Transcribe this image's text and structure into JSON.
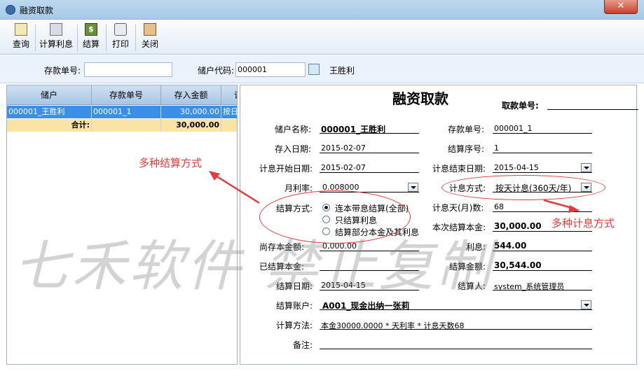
{
  "window": {
    "title": "融资取款",
    "close_label": "✕"
  },
  "toolbar": {
    "query": "查询",
    "calc_interest": "计算利息",
    "settle": "结算",
    "print": "打印",
    "close": "关闭",
    "settle_icon_text": "$"
  },
  "search": {
    "deposit_no_label": "存款单号:",
    "deposit_no_value": "",
    "account_code_label": "储户代码:",
    "account_code_value": "000001",
    "account_name": "王胜利"
  },
  "grid": {
    "columns": [
      "储户",
      "存款单号",
      "存入金额",
      "计"
    ],
    "rows": [
      {
        "account": "000001_王胜利",
        "deposit_no": "000001_1",
        "amount": "30,000.00",
        "method": "按日"
      }
    ],
    "total": {
      "label": "合计:",
      "amount": "30,000.00"
    }
  },
  "form": {
    "title": "融资取款",
    "withdraw_no_label": "取款单号:",
    "account_name_label": "储户名称:",
    "account_name": "000001_王胜利",
    "deposit_no_label": "存款单号:",
    "deposit_no": "000001_1",
    "deposit_date_label": "存入日期:",
    "deposit_date": "2015-02-07",
    "settle_seq_label": "结算序号:",
    "settle_seq": "1",
    "interest_start_label": "计息开始日期:",
    "interest_start": "2015-02-07",
    "interest_end_label": "计息结束日期:",
    "interest_end": "2015-04-15",
    "monthly_rate_label": "月利率:",
    "monthly_rate": "0.008000",
    "interest_mode_label": "计息方式:",
    "interest_mode": "按天计息(360天/年)",
    "settle_mode_label": "结算方式:",
    "settle_options": [
      "连本带息结算(全部)",
      "只结算利息",
      "结算部分本金及其利息"
    ],
    "interest_days_label": "计息天(月)数:",
    "interest_days": "68",
    "principal_label": "本次结算本金:",
    "principal": "30,000.00",
    "remaining_label": "尚存本金额:",
    "remaining": "0,000.00",
    "interest_label": "利息:",
    "interest": "544.00",
    "settled_principal_label": "已结算本金:",
    "settled_principal": "",
    "settle_amount_label": "结算金额:",
    "settle_amount": "30,544.00",
    "settle_date_label": "结算日期:",
    "settle_date": "2015-04-15",
    "settler_label": "结算人:",
    "settler": "system_系统管理员",
    "settle_account_label": "结算账户:",
    "settle_account": "A001_现金出纳一张莉",
    "calc_method_label": "计算方法:",
    "calc_method": "本金30000.0000 * 天利率 * 计息天数68",
    "remark_label": "备注:",
    "remark": ""
  },
  "annotations": {
    "settle_modes": "多种结算方式",
    "interest_modes": "多种计息方式",
    "color": "#e23b3b"
  },
  "watermark": "七禾软件 禁止复制"
}
